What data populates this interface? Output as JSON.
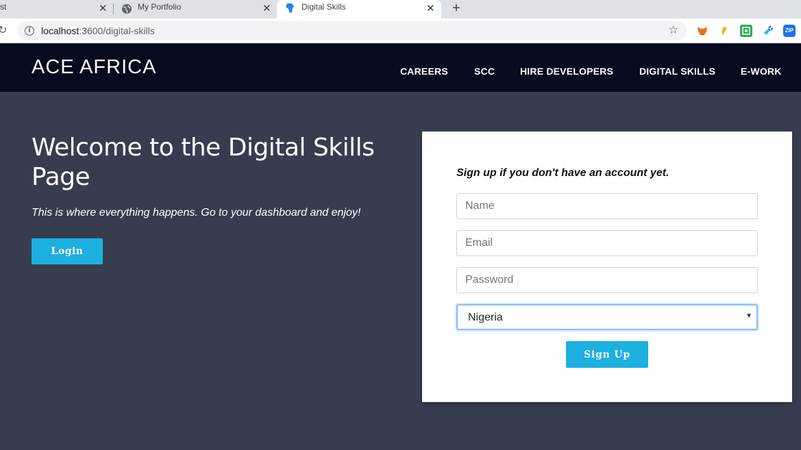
{
  "browser": {
    "tabs": [
      {
        "title": "st",
        "active": false
      },
      {
        "title": "My Portfolio",
        "active": false
      },
      {
        "title": "Digital Skills",
        "active": true
      }
    ],
    "close_glyph": "✕",
    "new_tab_glyph": "+",
    "url_host": "localhost",
    "url_path": ":3600/digital-skills",
    "extensions": [
      "metamask-icon",
      "ear-icon",
      "screenshot-icon",
      "plug-icon",
      "zip-icon"
    ],
    "zip_label": "ZIP"
  },
  "header": {
    "brand": "ACE AFRICA",
    "nav": [
      "CAREERS",
      "SCC",
      "HIRE DEVELOPERS",
      "DIGITAL SKILLS",
      "E-WORK"
    ]
  },
  "hero": {
    "title": "Welcome to the Digital Skills Page",
    "subtitle": "This is where everything happens. Go to your dashboard and enjoy!",
    "login_label": "Login"
  },
  "signup": {
    "heading": "Sign up if you don't have an account yet.",
    "name_placeholder": "Name",
    "email_placeholder": "Email",
    "password_placeholder": "Password",
    "country_selected": "Nigeria",
    "submit_label": "Sign Up"
  },
  "colors": {
    "page_bg": "#373d4f",
    "header_bg": "#060b1e",
    "accent": "#1cb0e0",
    "card_bg": "#ffffff"
  }
}
